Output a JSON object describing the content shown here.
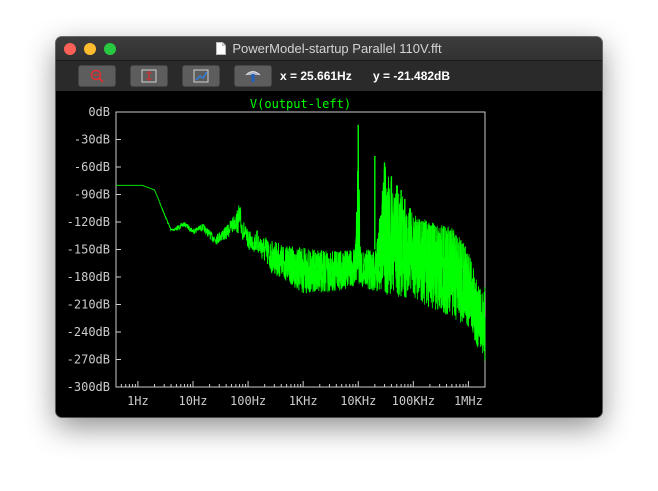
{
  "window": {
    "title": "PowerModel-startup Parallel 110V.fft"
  },
  "toolbar": {
    "buttons": [
      {
        "icon": "zoom-out-icon"
      },
      {
        "icon": "autorange-icon"
      },
      {
        "icon": "zoom-reset-icon"
      },
      {
        "icon": "scope-probe-icon"
      }
    ],
    "cursor_x": "x = 25.661Hz",
    "cursor_y": "y = -21.482dB"
  },
  "colors": {
    "trace": "#00ff00",
    "axis": "#cccccc",
    "tick_text": "#cccccc",
    "background": "#000000"
  },
  "chart_data": {
    "type": "line",
    "title": "V(output-left)",
    "xlabel": "",
    "ylabel": "",
    "xscale": "log",
    "xlim": [
      0.4,
      2000000
    ],
    "ylim": [
      -300,
      0
    ],
    "grid": false,
    "y_ticks": [
      "0dB",
      "-30dB",
      "-60dB",
      "-90dB",
      "-120dB",
      "-150dB",
      "-180dB",
      "-210dB",
      "-240dB",
      "-270dB",
      "-300dB"
    ],
    "y_tick_values": [
      0,
      -30,
      -60,
      -90,
      -120,
      -150,
      -180,
      -210,
      -240,
      -270,
      -300
    ],
    "x_ticks": [
      "1Hz",
      "10Hz",
      "100Hz",
      "1KHz",
      "10KHz",
      "100KHz",
      "1MHz"
    ],
    "x_tick_values": [
      1,
      10,
      100,
      1000,
      10000,
      100000,
      1000000
    ],
    "series": [
      {
        "name": "V(output-left)",
        "envelope_upper": [
          [
            0.4,
            -80
          ],
          [
            1.2,
            -80
          ],
          [
            2,
            -85
          ],
          [
            3,
            -110
          ],
          [
            4,
            -128
          ],
          [
            5,
            -125
          ],
          [
            7,
            -120
          ],
          [
            10,
            -128
          ],
          [
            15,
            -122
          ],
          [
            25,
            -135
          ],
          [
            40,
            -125
          ],
          [
            60,
            -110
          ],
          [
            70,
            -98
          ],
          [
            80,
            -115
          ],
          [
            100,
            -130
          ],
          [
            150,
            -128
          ],
          [
            250,
            -138
          ],
          [
            500,
            -145
          ],
          [
            1000,
            -148
          ],
          [
            3000,
            -152
          ],
          [
            8000,
            -150
          ],
          [
            9000,
            -140
          ],
          [
            10000,
            -14
          ],
          [
            11000,
            -150
          ],
          [
            20000,
            -150
          ],
          [
            20000,
            -48
          ],
          [
            21000,
            -152
          ],
          [
            30000,
            -55
          ],
          [
            40000,
            -70
          ],
          [
            60000,
            -85
          ],
          [
            100000,
            -110
          ],
          [
            200000,
            -120
          ],
          [
            500000,
            -125
          ],
          [
            1000000,
            -150
          ],
          [
            1500000,
            -190
          ],
          [
            2000000,
            -190
          ]
        ],
        "envelope_lower": [
          [
            0.4,
            -80
          ],
          [
            1.2,
            -80
          ],
          [
            2,
            -86
          ],
          [
            3,
            -112
          ],
          [
            4,
            -130
          ],
          [
            5,
            -130
          ],
          [
            7,
            -125
          ],
          [
            10,
            -133
          ],
          [
            15,
            -130
          ],
          [
            25,
            -145
          ],
          [
            40,
            -140
          ],
          [
            60,
            -130
          ],
          [
            80,
            -140
          ],
          [
            100,
            -150
          ],
          [
            150,
            -155
          ],
          [
            250,
            -175
          ],
          [
            500,
            -185
          ],
          [
            1000,
            -198
          ],
          [
            3000,
            -198
          ],
          [
            10000,
            -190
          ],
          [
            30000,
            -200
          ],
          [
            100000,
            -205
          ],
          [
            300000,
            -218
          ],
          [
            1000000,
            -235
          ],
          [
            2000000,
            -275
          ]
        ],
        "peaks": [
          {
            "x": 10000,
            "y": -14
          },
          {
            "x": 20000,
            "y": -48
          },
          {
            "x": 30000,
            "y": -55
          },
          {
            "x": 40000,
            "y": -70
          },
          {
            "x": 50000,
            "y": -80
          },
          {
            "x": 60000,
            "y": -85
          },
          {
            "x": 70000,
            "y": -95
          }
        ]
      }
    ]
  }
}
